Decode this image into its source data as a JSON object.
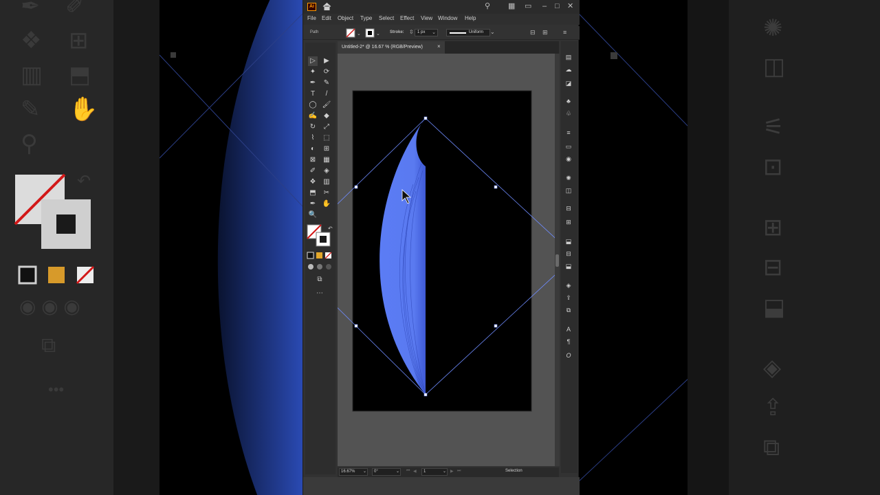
{
  "window": {
    "app_icon_label": "Ai",
    "menu": [
      "File",
      "Edit",
      "Object",
      "Type",
      "Select",
      "Effect",
      "View",
      "Window",
      "Help"
    ]
  },
  "control_bar": {
    "selection_type": "Path",
    "stroke_label": "Stroke:",
    "stroke_weight": "1 px",
    "profile": "Uniform"
  },
  "document": {
    "tab_title": "Untitled-2* @ 16.67 % (RGB/Preview)",
    "close_glyph": "×"
  },
  "status_bar": {
    "zoom": "16.67%",
    "rotation": "0°",
    "artboard_number": "1",
    "tool_name": "Selection"
  },
  "colors": {
    "shape_fill": "#5b7cf5",
    "selection_outline": "#6f8cff",
    "artboard": "#000000",
    "canvas_bg": "#535353"
  },
  "tools": [
    "selection-tool",
    "direct-selection-tool",
    "magic-wand-tool",
    "lasso-tool",
    "pen-tool",
    "curvature-tool",
    "type-tool",
    "line-tool",
    "ellipse-tool",
    "paintbrush-tool",
    "shaper-tool",
    "eraser-tool",
    "rotate-tool",
    "scale-tool",
    "warp-tool",
    "free-transform-tool",
    "shape-builder-tool",
    "perspective-tool",
    "mesh-tool",
    "gradient-tool",
    "eyedropper-tool",
    "blend-tool",
    "symbol-sprayer-tool",
    "column-graph-tool",
    "artboard-tool",
    "slice-tool",
    "hand-tool",
    "zoom-tool"
  ],
  "tool_glyphs": [
    "▷",
    "▶",
    "✦",
    "⟳",
    "✒",
    "✎",
    "T",
    "/",
    "◯",
    "🖌",
    "✍",
    "◆",
    "↻",
    "⤢",
    "⌇",
    "⬚",
    "◐",
    "⊞",
    "⊠",
    "▦",
    "✐",
    "◈",
    "❖",
    "▥",
    "⬒",
    "✂",
    "✋",
    "🔍"
  ],
  "right_panel_icons": [
    "properties-icon",
    "libraries-icon",
    "color-guide-icon",
    "brushes-icon",
    "symbols-icon",
    "stroke-icon",
    "gradient-icon",
    "transparency-icon",
    "appearance-icon",
    "graphic-styles-icon",
    "align-icon",
    "transform-icon",
    "pathfinder-icon",
    "layers-icon",
    "artboards-icon",
    "asset-export-icon",
    "character-icon",
    "paragraph-icon",
    "opentype-icon"
  ],
  "right_panel_glyphs": [
    "▤",
    "☁",
    "◪",
    "♣",
    "♧",
    "≡",
    "▭",
    "◉",
    "✺",
    "◫",
    "⊟",
    "⊞",
    "⬓",
    "◈",
    "⧉",
    "⇪",
    "A",
    "¶",
    "O"
  ]
}
